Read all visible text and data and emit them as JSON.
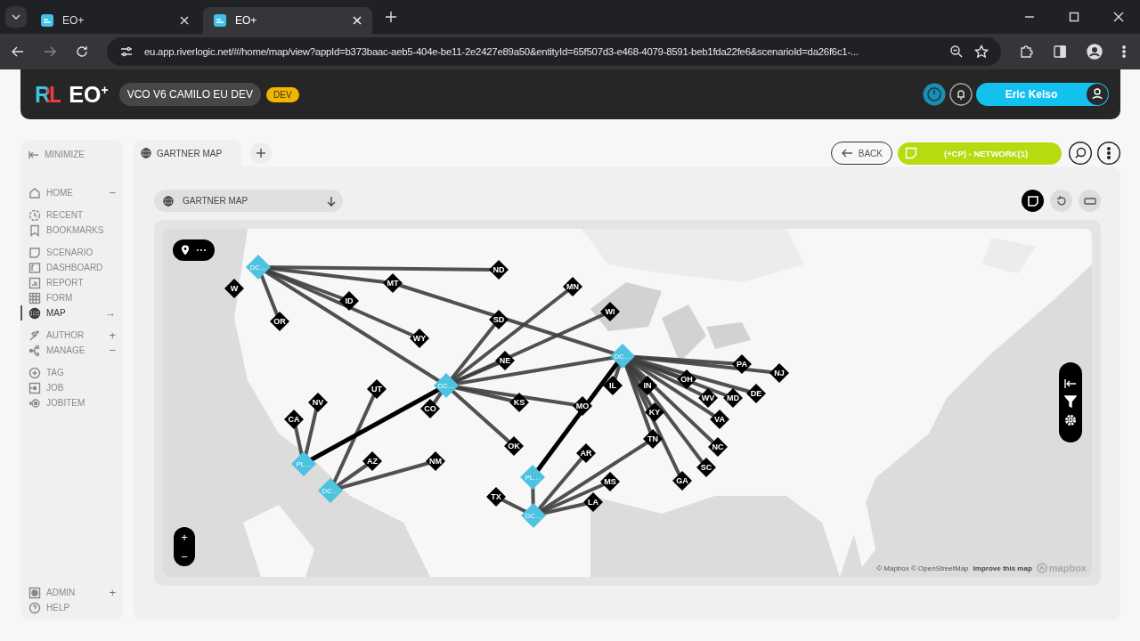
{
  "browser": {
    "tabs": [
      {
        "title": "EO+",
        "selected": false
      },
      {
        "title": "EO+",
        "selected": true
      }
    ],
    "url": "eu.app.riverlogic.net/#/home/map/view?appId=b373baac-aeb5-404e-be11-2e2427e89a50&entityId=65f507d3-e468-4079-8591-beb1fda22fe6&scenarioId=da26f6c1-..."
  },
  "header": {
    "logo_mark": "RL",
    "product": "EO$^{+}$",
    "environment": "VCO V6 CAMILO EU DEV",
    "badge": "DEV",
    "user": "Eric Kelso"
  },
  "sidebar": {
    "minimize": "MINIMIZE",
    "groups": [
      [
        {
          "label": "HOME",
          "trailing": "−",
          "selected": false
        }
      ],
      [
        {
          "label": "RECENT",
          "selected": false
        },
        {
          "label": "BOOKMARKS",
          "selected": false
        }
      ],
      [
        {
          "label": "SCENARIO",
          "selected": false
        },
        {
          "label": "DASHBOARD",
          "selected": false
        },
        {
          "label": "REPORT",
          "selected": false
        },
        {
          "label": "FORM",
          "selected": false
        },
        {
          "label": "MAP",
          "trailing": "→",
          "selected": true
        }
      ],
      [
        {
          "label": "AUTHOR",
          "trailing": "+",
          "selected": false
        },
        {
          "label": "MANAGE",
          "trailing": "−",
          "selected": false
        }
      ],
      [
        {
          "label": "TAG",
          "selected": false
        },
        {
          "label": "JOB",
          "selected": false
        },
        {
          "label": "JOBITEM",
          "selected": false
        }
      ]
    ],
    "footer": [
      {
        "label": "ADMIN",
        "trailing": "+",
        "selected": false
      },
      {
        "label": "HELP",
        "selected": false
      }
    ]
  },
  "tabs": [
    {
      "label": "GARTNER MAP",
      "selected": true
    }
  ],
  "toolbar": {
    "back": "BACK",
    "scenario": "(+CP) - NETWORK(1)"
  },
  "view_select": {
    "value": "GARTNER MAP"
  },
  "view_modes": [
    {
      "selected": true
    },
    {
      "selected": false
    },
    {
      "selected": false
    }
  ],
  "map": {
    "nodes": [
      {
        "label": "DC…",
        "kind": "facility"
      },
      {
        "label": "ND",
        "kind": "customer"
      },
      {
        "label": "W",
        "kind": "customer"
      },
      {
        "label": "MT",
        "kind": "customer"
      },
      {
        "label": "MN",
        "kind": "customer"
      },
      {
        "label": "ID",
        "kind": "customer"
      },
      {
        "label": "OR",
        "kind": "customer"
      },
      {
        "label": "SD",
        "kind": "customer"
      },
      {
        "label": "WI",
        "kind": "customer"
      },
      {
        "label": "WY",
        "kind": "customer"
      },
      {
        "label": "NE",
        "kind": "customer"
      },
      {
        "label": "DC…",
        "kind": "facility"
      },
      {
        "label": "PA",
        "kind": "customer"
      },
      {
        "label": "NJ",
        "kind": "customer"
      },
      {
        "label": "UT",
        "kind": "customer"
      },
      {
        "label": "DC…",
        "kind": "facility"
      },
      {
        "label": "IL",
        "kind": "customer"
      },
      {
        "label": "IN",
        "kind": "customer"
      },
      {
        "label": "OH",
        "kind": "customer"
      },
      {
        "label": "WV",
        "kind": "customer"
      },
      {
        "label": "MD",
        "kind": "customer"
      },
      {
        "label": "DE",
        "kind": "customer"
      },
      {
        "label": "NV",
        "kind": "customer"
      },
      {
        "label": "CO",
        "kind": "customer"
      },
      {
        "label": "KS",
        "kind": "customer"
      },
      {
        "label": "MO",
        "kind": "customer"
      },
      {
        "label": "KY",
        "kind": "customer"
      },
      {
        "label": "CA",
        "kind": "customer"
      },
      {
        "label": "VA",
        "kind": "customer"
      },
      {
        "label": "OK",
        "kind": "customer"
      },
      {
        "label": "AR",
        "kind": "customer"
      },
      {
        "label": "TN",
        "kind": "customer"
      },
      {
        "label": "NC",
        "kind": "customer"
      },
      {
        "label": "PL…",
        "kind": "facility"
      },
      {
        "label": "AZ",
        "kind": "customer"
      },
      {
        "label": "NM",
        "kind": "customer"
      },
      {
        "label": "SC",
        "kind": "customer"
      },
      {
        "label": "DC…",
        "kind": "facility"
      },
      {
        "label": "PL…",
        "kind": "facility"
      },
      {
        "label": "MS",
        "kind": "customer"
      },
      {
        "label": "GA",
        "kind": "customer"
      },
      {
        "label": "TX",
        "kind": "customer"
      },
      {
        "label": "DC…",
        "kind": "facility"
      },
      {
        "label": "LA",
        "kind": "customer"
      }
    ],
    "zoom_in": "+",
    "zoom_out": "−",
    "attribution": "© Mapbox © OpenStreetMap",
    "improve": "Improve this map",
    "brand": "mapbox"
  }
}
